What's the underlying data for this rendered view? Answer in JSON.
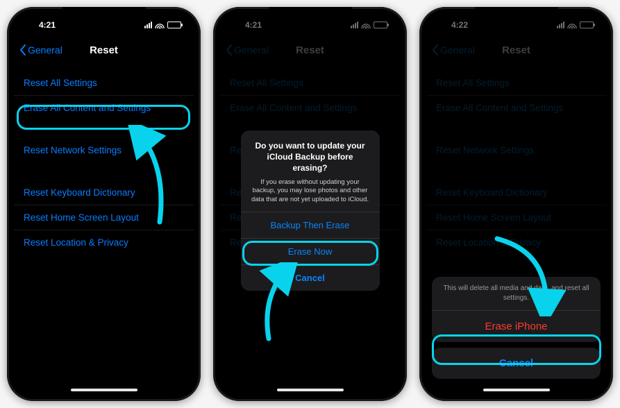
{
  "phones": [
    {
      "time": "4:21",
      "back": "General",
      "title": "Reset",
      "groups": [
        [
          "Reset All Settings",
          "Erase All Content and Settings"
        ],
        [
          "Reset Network Settings"
        ],
        [
          "Reset Keyboard Dictionary",
          "Reset Home Screen Layout",
          "Reset Location & Privacy"
        ]
      ]
    },
    {
      "time": "4:21",
      "back": "General",
      "title": "Reset",
      "groups": [
        [
          "Reset All Settings",
          "Erase All Content and Settings"
        ],
        [
          "Reset Network Settings"
        ],
        [
          "Reset Keyboard Dictionary",
          "Reset Home Screen Layout",
          "Reset Location & Privacy"
        ]
      ],
      "alert": {
        "title": "Do you want to update your iCloud Backup before erasing?",
        "message": "If you erase without updating your backup, you may lose photos and other data that are not yet uploaded to iCloud.",
        "buttons": [
          "Backup Then Erase",
          "Erase Now",
          "Cancel"
        ]
      }
    },
    {
      "time": "4:22",
      "back": "General",
      "title": "Reset",
      "groups": [
        [
          "Reset All Settings",
          "Erase All Content and Settings"
        ],
        [
          "Reset Network Settings"
        ],
        [
          "Reset Keyboard Dictionary",
          "Reset Home Screen Layout",
          "Reset Location & Privacy"
        ]
      ],
      "sheet": {
        "message": "This will delete all media and data, and reset all settings.",
        "destructive": "Erase iPhone",
        "cancel": "Cancel"
      }
    }
  ],
  "colors": {
    "accent": "#0a7cff",
    "highlight": "#09d3ec",
    "destructive": "#ff3b30"
  }
}
